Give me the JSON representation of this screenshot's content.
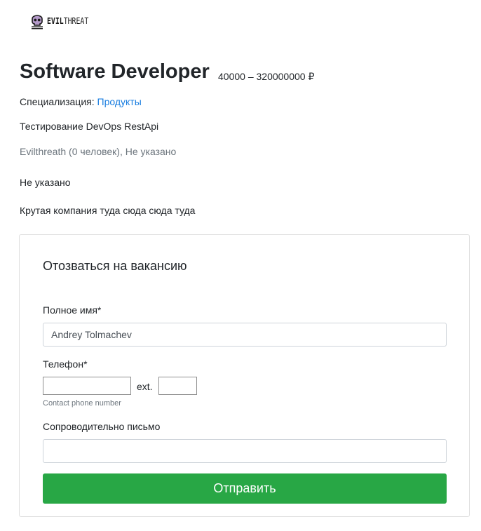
{
  "brand": {
    "logo_icon": "skull-icon",
    "name_bold": "EVIL",
    "name_regular": "THREAT"
  },
  "vacancy": {
    "title": "Software Developer",
    "salary": "40000 – 320000000 ₽",
    "specialization_label": "Специализация:",
    "specialization_value": "Продукты",
    "skills": "Тестирование DevOps RestApi",
    "company_info": "Evilthreath (0 человек), Не указано",
    "location": "Не указано",
    "description": "Крутая компания туда сюда сюда туда"
  },
  "apply_form": {
    "title": "Отозваться на вакансию",
    "full_name_label": "Полное имя*",
    "full_name_value": "Andrey Tolmachev",
    "phone_label": "Телефон*",
    "phone_value": "",
    "ext_label": "ext.",
    "ext_value": "",
    "phone_hint": "Contact phone number",
    "cover_letter_label": "Сопроводительно письмо",
    "cover_letter_value": "",
    "submit_label": "Отправить"
  },
  "colors": {
    "link": "#1a7ee0",
    "submit_button": "#28a745",
    "muted_text": "#6c757d"
  }
}
